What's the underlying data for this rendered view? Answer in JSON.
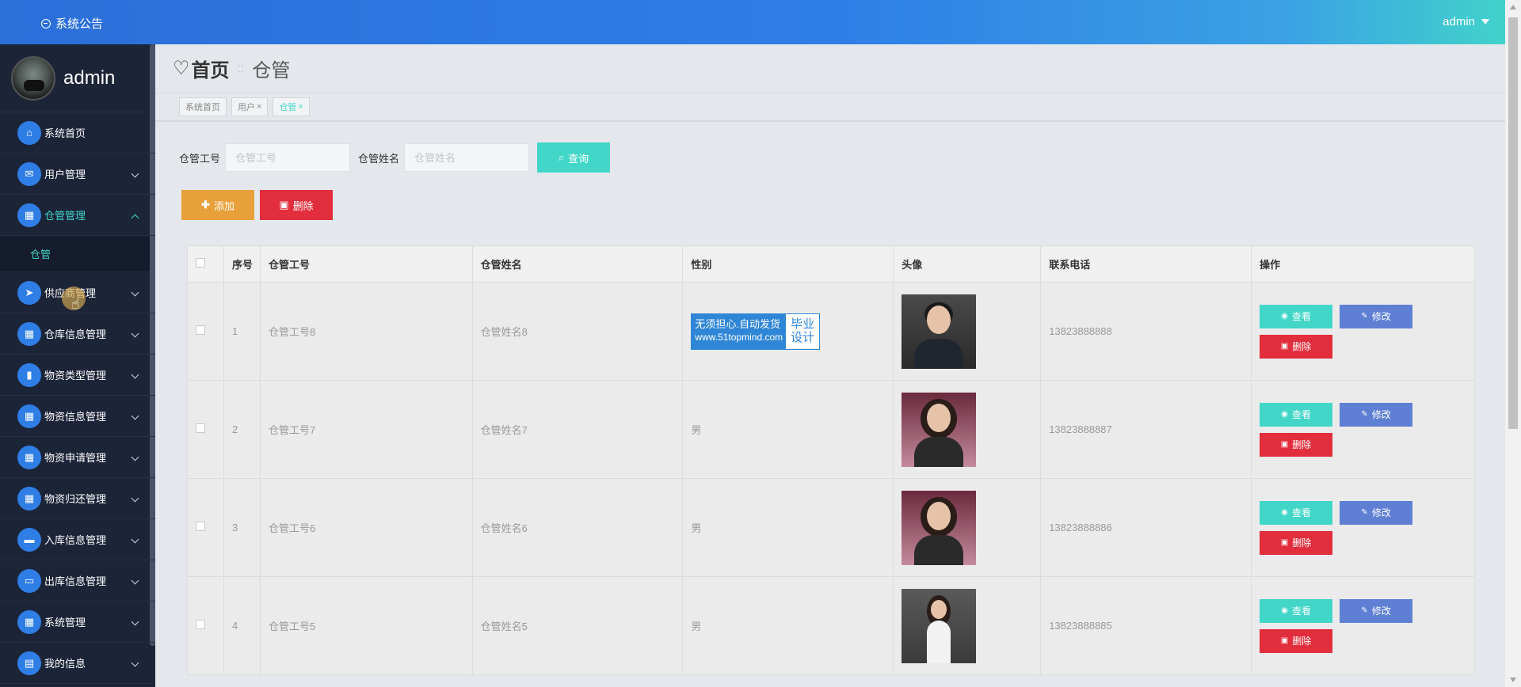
{
  "topbar": {
    "notice_label": "系统公告",
    "user_label": "admin"
  },
  "sidebar": {
    "profile_name": "admin",
    "items": [
      {
        "label": "系统首页",
        "icon": "home-icon",
        "glyph": "⌂",
        "chevron": false
      },
      {
        "label": "用户管理",
        "icon": "chat-icon",
        "glyph": "✉",
        "chevron": true
      },
      {
        "label": "仓管管理",
        "icon": "grid-icon",
        "glyph": "▦",
        "chevron": true,
        "expanded": true
      },
      {
        "label": "供应商管理",
        "icon": "send-icon",
        "glyph": "➤",
        "chevron": true
      },
      {
        "label": "仓库信息管理",
        "icon": "grid-icon",
        "glyph": "▦",
        "chevron": true
      },
      {
        "label": "物资类型管理",
        "icon": "book-icon",
        "glyph": "▮",
        "chevron": true
      },
      {
        "label": "物资信息管理",
        "icon": "grid-icon",
        "glyph": "▦",
        "chevron": true
      },
      {
        "label": "物资申请管理",
        "icon": "grid-icon",
        "glyph": "▦",
        "chevron": true
      },
      {
        "label": "物资归还管理",
        "icon": "grid-icon",
        "glyph": "▦",
        "chevron": true
      },
      {
        "label": "入库信息管理",
        "icon": "ticket-icon",
        "glyph": "▬",
        "chevron": true
      },
      {
        "label": "出库信息管理",
        "icon": "monitor-icon",
        "glyph": "▭",
        "chevron": true
      },
      {
        "label": "系统管理",
        "icon": "apps-icon",
        "glyph": "▦",
        "chevron": true
      },
      {
        "label": "我的信息",
        "icon": "card-icon",
        "glyph": "▤",
        "chevron": true
      }
    ],
    "subitem": "仓管"
  },
  "header": {
    "title": "首页",
    "separator": "::",
    "current": "仓管"
  },
  "tags": [
    {
      "label": "系统首页",
      "closable": false,
      "active": false
    },
    {
      "label": "用户",
      "closable": true,
      "active": false
    },
    {
      "label": "仓管",
      "closable": true,
      "active": true
    }
  ],
  "search": {
    "field1_label": "仓管工号",
    "field1_placeholder": "仓管工号",
    "field1_value": "",
    "field2_label": "仓管姓名",
    "field2_placeholder": "仓管姓名",
    "field2_value": "",
    "query_label": "查询"
  },
  "actions": {
    "add_label": "添加",
    "delete_label": "删除"
  },
  "table": {
    "headers": [
      "",
      "序号",
      "仓管工号",
      "仓管姓名",
      "性别",
      "头像",
      "联系电话",
      "操作"
    ],
    "rows": [
      {
        "index": "1",
        "id": "仓管工号8",
        "name": "仓管姓名8",
        "gender": "",
        "phone": "13823888888",
        "avatar": "male-suit"
      },
      {
        "index": "2",
        "id": "仓管工号7",
        "name": "仓管姓名7",
        "gender": "男",
        "phone": "13823888887",
        "avatar": "female-pink"
      },
      {
        "index": "3",
        "id": "仓管工号6",
        "name": "仓管姓名6",
        "gender": "男",
        "phone": "13823888886",
        "avatar": "female-pink"
      },
      {
        "index": "4",
        "id": "仓管工号5",
        "name": "仓管姓名5",
        "gender": "男",
        "phone": "13823888885",
        "avatar": "female-standing"
      }
    ],
    "op_view": "查看",
    "op_edit": "修改",
    "op_delete": "删除"
  },
  "watermark": {
    "line1": "无须担心.自动发货",
    "line2": "www.51topmind.com",
    "right1": "毕业",
    "right2": "设计"
  },
  "colors": {
    "accent": "#42d6c8",
    "primary": "#2f7ee6",
    "add": "#e8a03a",
    "danger": "#e12d3c",
    "edit": "#5e7fd4",
    "sidebar": "#1c2438"
  }
}
